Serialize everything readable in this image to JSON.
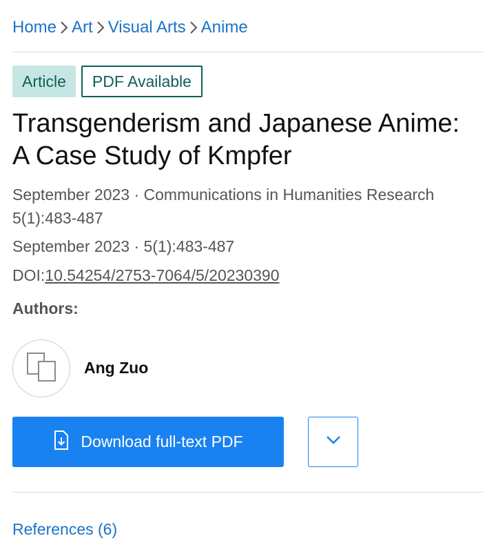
{
  "breadcrumb": {
    "items": [
      {
        "label": "Home"
      },
      {
        "label": "Art"
      },
      {
        "label": "Visual Arts"
      },
      {
        "label": "Anime"
      }
    ]
  },
  "badges": {
    "type_label": "Article",
    "pdf_label": "PDF Available"
  },
  "publication": {
    "title": "Transgenderism and Japanese Anime: A Case Study of Kmpfer",
    "meta_line1": "September 2023 · Communications in Humanities Research 5(1):483-487",
    "meta_line2": "September 2023 · 5(1):483-487",
    "doi_prefix": "DOI:",
    "doi": "10.54254/2753-7064/5/20230390"
  },
  "authors": {
    "heading": "Authors:",
    "list": [
      {
        "name": "Ang Zuo",
        "avatar_icon": "placeholder-avatar-icon"
      }
    ]
  },
  "actions": {
    "download_label": "Download full-text PDF",
    "download_icon": "file-download-icon",
    "more_icon": "chevron-down-icon",
    "button_color": "#1a82f0"
  },
  "tabs": {
    "references_label": "References (6)"
  },
  "colors": {
    "link": "#1a73c7",
    "badge_teal": "#0f5f58",
    "badge_bg": "#c6e6e3"
  }
}
